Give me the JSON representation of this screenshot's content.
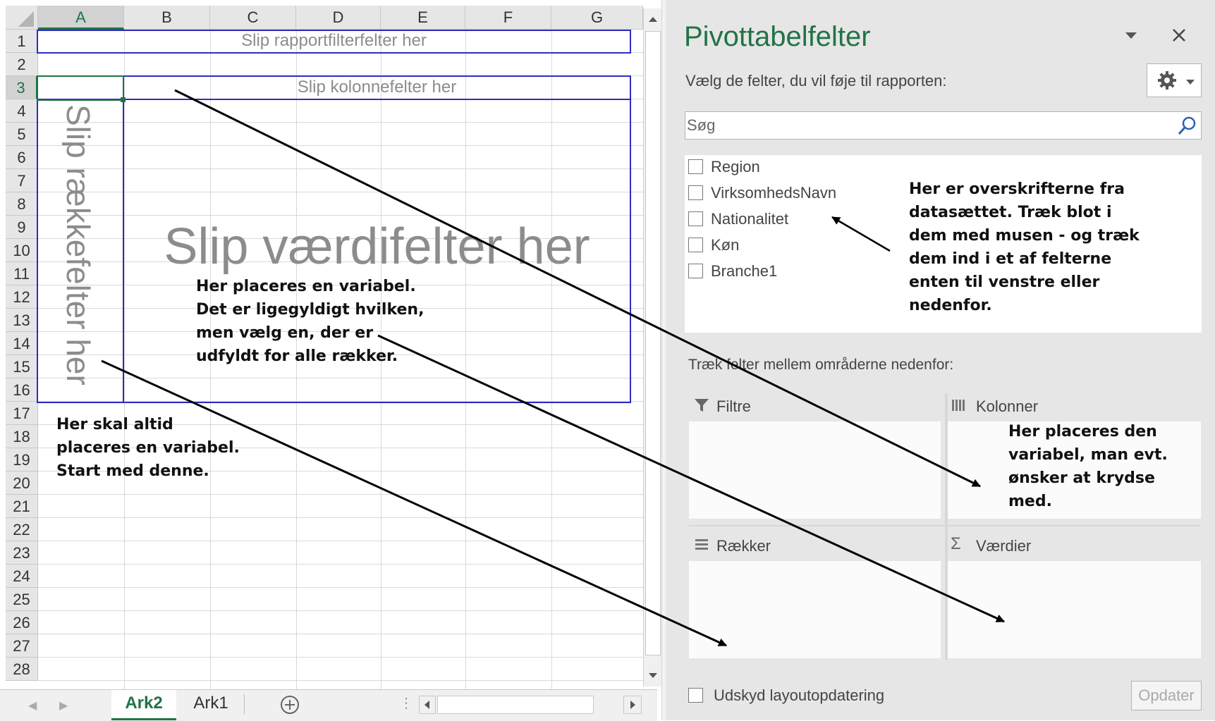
{
  "sheet": {
    "columns": [
      "A",
      "B",
      "C",
      "D",
      "E",
      "F",
      "G"
    ],
    "rows": [
      "1",
      "2",
      "3",
      "4",
      "5",
      "6",
      "7",
      "8",
      "9",
      "10",
      "11",
      "12",
      "13",
      "14",
      "15",
      "16",
      "17",
      "18",
      "19",
      "20",
      "21",
      "22",
      "23",
      "24",
      "25",
      "26",
      "27",
      "28"
    ],
    "selected_cell": "A3",
    "pivot": {
      "report_filter_label": "Slip rapportfilterfelter her",
      "column_label": "Slip kolonnefelter her",
      "row_label": "Slip rækkefelter her",
      "values_label": "Slip værdifelter her"
    },
    "notes": {
      "values_note": [
        "Her placeres en variabel.",
        "Det er ligegyldigt hvilken,",
        "men vælg en, der er",
        "udfyldt for alle rækker."
      ],
      "rows_note": [
        "Her skal altid",
        "placeres en variabel.",
        "Start med denne."
      ]
    },
    "tabs": [
      {
        "label": "Ark2",
        "active": true
      },
      {
        "label": "Ark1",
        "active": false
      }
    ]
  },
  "pane": {
    "title": "Pivottabelfelter",
    "subtitle": "Vælg de felter, du vil føje til rapporten:",
    "search_placeholder": "Søg",
    "fields": [
      "Region",
      "VirksomhedsNavn",
      "Nationalitet",
      "Køn",
      "Branche1"
    ],
    "fields_note": [
      "Her er overskrifterne fra",
      "datasættet. Træk blot i",
      "dem med musen - og træk",
      "dem ind i et af felterne",
      "enten til venstre eller",
      "nedenfor."
    ],
    "drag_label": "Træk felter mellem områderne nedenfor:",
    "areas": {
      "filters": "Filtre",
      "columns": "Kolonner",
      "rows": "Rækker",
      "values": "Værdier"
    },
    "columns_note": [
      "Her placeres den",
      "variabel, man evt.",
      "ønsker at krydse",
      "med."
    ],
    "defer_label": "Udskyd layoutopdatering",
    "update_button": "Opdater"
  },
  "icons": {
    "dropdown": "chevron-down-icon",
    "close": "close-icon",
    "settings": "gear-icon",
    "search": "search-icon",
    "filter": "filter-icon",
    "columns": "columns-icon",
    "rows": "rows-icon",
    "values": "sigma-icon",
    "add_sheet": "plus-circle-icon"
  }
}
